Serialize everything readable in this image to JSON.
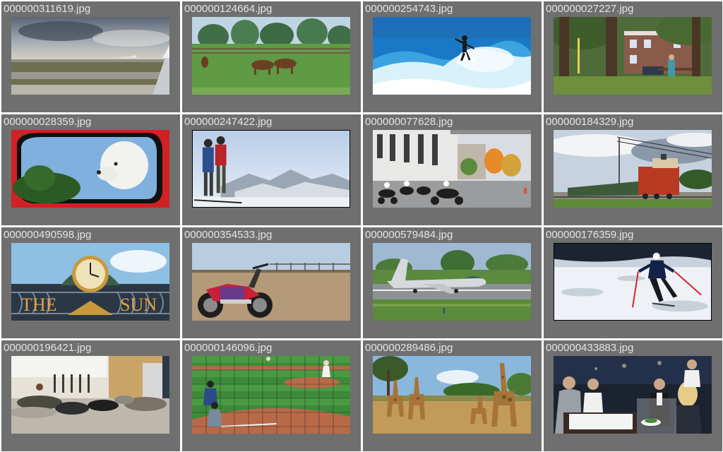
{
  "gallery": {
    "items": [
      {
        "filename": "000000311619.jpg",
        "scene": "airport-runway"
      },
      {
        "filename": "000000124664.jpg",
        "scene": "horses-pasture"
      },
      {
        "filename": "000000254743.jpg",
        "scene": "surfer-wave"
      },
      {
        "filename": "000000027227.jpg",
        "scene": "park-bench"
      },
      {
        "filename": "000000028359.jpg",
        "scene": "dog-car-mirror"
      },
      {
        "filename": "000000247422.jpg",
        "scene": "skiers-mountains"
      },
      {
        "filename": "000000077628.jpg",
        "scene": "police-motorcycles"
      },
      {
        "filename": "000000184329.jpg",
        "scene": "train-tracks"
      },
      {
        "filename": "000000490598.jpg",
        "scene": "clock-sign"
      },
      {
        "filename": "000000354533.jpg",
        "scene": "motorcycle-field"
      },
      {
        "filename": "000000579484.jpg",
        "scene": "jet-airplane"
      },
      {
        "filename": "000000176359.jpg",
        "scene": "skier-snow"
      },
      {
        "filename": "000000196421.jpg",
        "scene": "airport-sleepers"
      },
      {
        "filename": "000000146096.jpg",
        "scene": "baseball-game"
      },
      {
        "filename": "000000289486.jpg",
        "scene": "giraffes-savanna"
      },
      {
        "filename": "000000433883.jpg",
        "scene": "restaurant-diners"
      }
    ]
  },
  "colors": {
    "tile_background": "#6f6f6f",
    "caption_text": "#e4e4e4",
    "page_background": "#ffffff"
  }
}
